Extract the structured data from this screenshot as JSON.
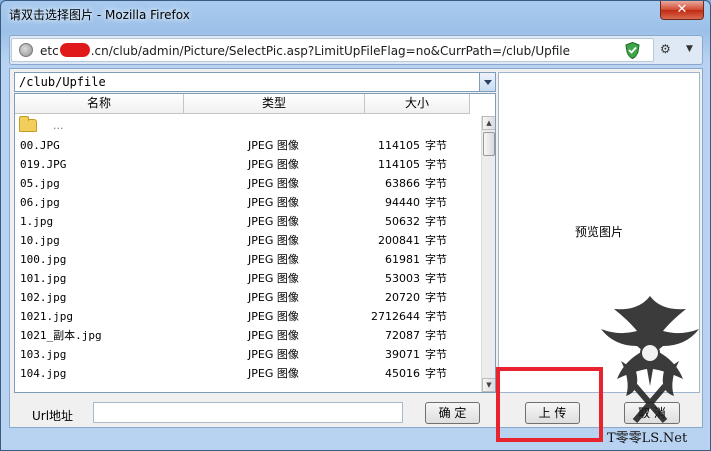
{
  "window": {
    "title": "请双击选择图片 - Mozilla Firefox",
    "close_glyph": "✕"
  },
  "address": {
    "url_prefix": "etc",
    "url_suffix": ".cn/club/admin/Picture/SelectPic.asp?LimitUpFileFlag=no&CurrPath=/club/Upfile",
    "icons": [
      "globe-icon",
      "shield-icon",
      "tools-icon",
      "chevron-down-icon"
    ]
  },
  "path_select": {
    "value": "/club/Upfile"
  },
  "columns": {
    "name": "名称",
    "type": "类型",
    "size": "大小"
  },
  "folder_up": {
    "label": "..."
  },
  "files": [
    {
      "name": "00.JPG",
      "type": "JPEG 图像",
      "size": "114105",
      "unit": "字节"
    },
    {
      "name": "019.JPG",
      "type": "JPEG 图像",
      "size": "114105",
      "unit": "字节"
    },
    {
      "name": "05.jpg",
      "type": "JPEG 图像",
      "size": "63866",
      "unit": "字节"
    },
    {
      "name": "06.jpg",
      "type": "JPEG 图像",
      "size": "94440",
      "unit": "字节"
    },
    {
      "name": "1.jpg",
      "type": "JPEG 图像",
      "size": "50632",
      "unit": "字节"
    },
    {
      "name": "10.jpg",
      "type": "JPEG 图像",
      "size": "200841",
      "unit": "字节"
    },
    {
      "name": "100.jpg",
      "type": "JPEG 图像",
      "size": "61981",
      "unit": "字节"
    },
    {
      "name": "101.jpg",
      "type": "JPEG 图像",
      "size": "53003",
      "unit": "字节"
    },
    {
      "name": "102.jpg",
      "type": "JPEG 图像",
      "size": "20720",
      "unit": "字节"
    },
    {
      "name": "1021.jpg",
      "type": "JPEG 图像",
      "size": "2712644",
      "unit": "字节"
    },
    {
      "name": "1021_副本.jpg",
      "type": "JPEG 图像",
      "size": "72087",
      "unit": "字节"
    },
    {
      "name": "103.jpg",
      "type": "JPEG 图像",
      "size": "39071",
      "unit": "字节"
    },
    {
      "name": "104.jpg",
      "type": "JPEG 图像",
      "size": "45016",
      "unit": "字节"
    }
  ],
  "preview": {
    "label": "预览图片"
  },
  "form": {
    "url_label": "Url地址",
    "url_value": "",
    "confirm": "确 定",
    "upload": "上 传",
    "cancel": "取 消"
  },
  "watermark": {
    "text": "T零零LS.Net"
  },
  "colors": {
    "highlight_box": "#e8232d",
    "close_button": "#c12a12"
  }
}
